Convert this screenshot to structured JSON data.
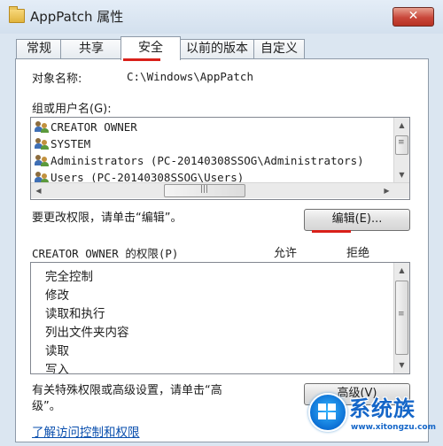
{
  "window": {
    "title": "AppPatch 属性",
    "close_glyph": "✕"
  },
  "tabs": [
    {
      "label": "常规"
    },
    {
      "label": "共享"
    },
    {
      "label": "安全"
    },
    {
      "label": "以前的版本"
    },
    {
      "label": "自定义"
    }
  ],
  "object": {
    "label": "对象名称:",
    "value": "C:\\Windows\\AppPatch"
  },
  "users": {
    "label": "组或用户名(G):",
    "items": [
      "CREATOR OWNER",
      "SYSTEM",
      "Administrators (PC-20140308SSOG\\Administrators)",
      "Users (PC-20140308SSOG\\Users)"
    ]
  },
  "edit": {
    "hint": "要更改权限，请单击“编辑”。",
    "button": "编辑(E)..."
  },
  "permissions": {
    "header": "CREATOR OWNER 的权限(P)",
    "allow_label": "允许",
    "deny_label": "拒绝",
    "items": [
      "完全控制",
      "修改",
      "读取和执行",
      "列出文件夹内容",
      "读取",
      "写入"
    ]
  },
  "advanced": {
    "hint_line1": "有关特殊权限或高级设置，请单击“高",
    "hint_line2": "级”。",
    "button": "高级(V)"
  },
  "link": {
    "label": "了解访问控制和权限"
  },
  "watermark": {
    "title": "系统族",
    "url": "www.xitongzu.com"
  },
  "colors": {
    "accent_red": "#d9201a",
    "link_blue": "#0a4fae",
    "window_bg": "#dbe6f1"
  }
}
